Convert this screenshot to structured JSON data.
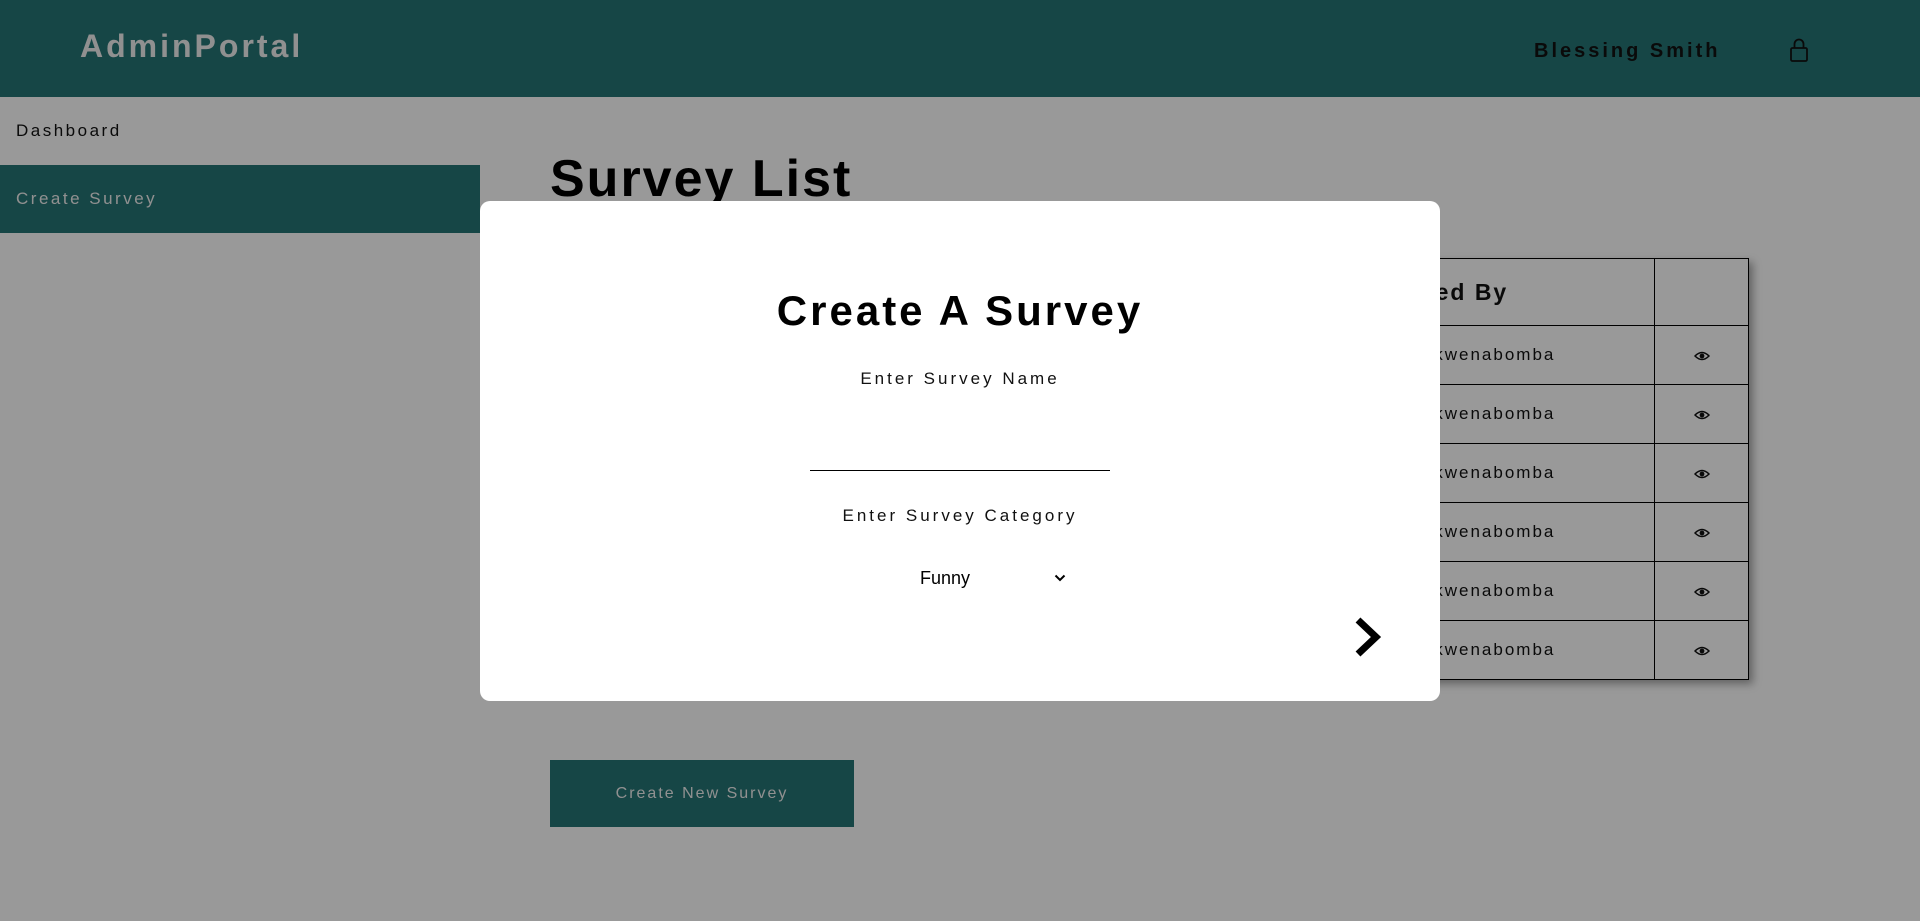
{
  "header": {
    "brand": "AdminPortal",
    "user_name": "Blessing Smith",
    "user_icon": "user-lock-icon"
  },
  "sidebar": {
    "items": [
      {
        "label": "Dashboard",
        "active": false
      },
      {
        "label": "Create Survey",
        "active": true
      }
    ]
  },
  "main": {
    "title": "Survey List",
    "table": {
      "headers": [
        "Created By",
        ""
      ],
      "rows": [
        {
          "created_by": "Blessing Mokwenabomba",
          "action_icon": "eye-icon"
        },
        {
          "created_by": "Blessing Mokwenabomba",
          "action_icon": "eye-icon"
        },
        {
          "created_by": "Blessing Mokwenabomba",
          "action_icon": "eye-icon"
        },
        {
          "created_by": "Blessing Mokwenabomba",
          "action_icon": "eye-icon"
        },
        {
          "created_by": "Blessing Mokwenabomba",
          "action_icon": "eye-icon"
        },
        {
          "created_by": "Blessing Mokwenabomba",
          "action_icon": "eye-icon"
        }
      ]
    },
    "create_button": "Create New Survey"
  },
  "modal": {
    "title": "Create A Survey",
    "name_label": "Enter Survey Name",
    "name_value": "",
    "category_label": "Enter Survey Category",
    "category_value": "Funny",
    "next_icon": "chevron-right-icon"
  },
  "colors": {
    "primary": "#267575",
    "overlay": "rgba(0,0,0,0.4)",
    "text": "#111111"
  }
}
